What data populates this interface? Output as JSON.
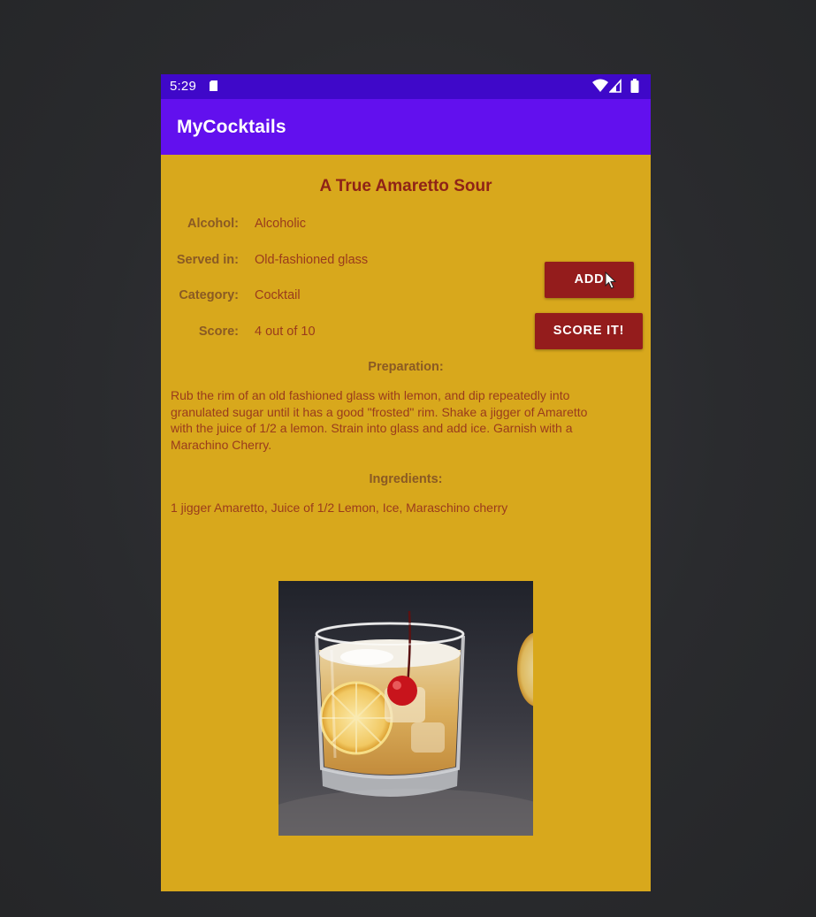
{
  "status_bar": {
    "time": "5:29",
    "icons": [
      "sd-card-icon",
      "wifi-icon",
      "signal-icon",
      "battery-icon"
    ]
  },
  "app_bar": {
    "title": "MyCocktails"
  },
  "drink": {
    "name": "A True Amaretto Sour",
    "fields": {
      "alcohol_label": "Alcohol:",
      "alcohol_value": "Alcoholic",
      "served_label": "Served in:",
      "served_value": "Old-fashioned glass",
      "category_label": "Category:",
      "category_value": "Cocktail",
      "score_label": "Score:",
      "score_value": "4 out of 10"
    },
    "preparation_heading": "Preparation:",
    "preparation_text": "Rub the rim of an old fashioned glass with lemon, and dip repeatedly into granulated sugar until it has a good \"frosted\" rim. Shake a jigger of Amaretto with the juice of 1/2 a lemon. Strain into glass and add ice. Garnish with a Marachino Cherry.",
    "ingredients_heading": "Ingredients:",
    "ingredients_text": "1 jigger  Amaretto, Juice of 1/2  Lemon, Ice, Maraschino cherry"
  },
  "buttons": {
    "add_label": "ADD",
    "score_label": "SCORE IT!"
  },
  "colors": {
    "status_bar": "#3f08c9",
    "app_bar": "#6210ee",
    "background": "#d8a81c",
    "button": "#941c1c",
    "title_text": "#8f2317",
    "label_text": "#8a5a24",
    "value_text": "#9a3b1c"
  }
}
